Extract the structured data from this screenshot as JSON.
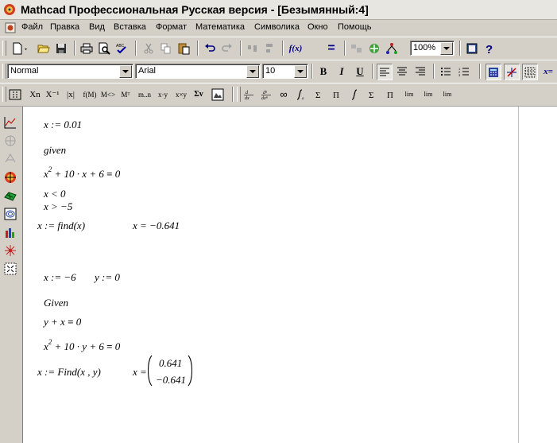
{
  "window": {
    "title": "Mathcad Профессиональная Русская версия - [Безымянный:4]"
  },
  "menu": [
    "Файл",
    "Правка",
    "Вид",
    "Вставка",
    "Формат",
    "Математика",
    "Символика",
    "Окно",
    "Помощь"
  ],
  "toolbar": {
    "zoom": "100%",
    "style": "Normal",
    "font": "Arial",
    "font_size": "10",
    "bold_label": "B",
    "italic_label": "I",
    "underline_label": "U",
    "fx_label": "f(x)",
    "equals_label": "=",
    "xeq_label": "x="
  },
  "palette_labels": {
    "subscript": "Xn",
    "inverse": "X⁻¹",
    "abs": "|x|",
    "vectorize": "f(M)",
    "superscript": "M<>",
    "transpose": "Mᵀ",
    "range": "m..n",
    "dot": "x·y",
    "cross": "x×y",
    "sum_vec": "Σv",
    "infinity": "∞",
    "lim": "lim"
  },
  "worksheet": {
    "expr1": "x := 0.01",
    "given1": "given",
    "eq1_left": "x",
    "eq1_rest": " + 10 · x + 6 ",
    "eq1_eq": "=",
    "eq1_rhs": " 0",
    "eq1_exp": "2",
    "ineq1": "x < 0",
    "ineq2": "x > −5",
    "find1": "x := find(x)",
    "result1": "x = −0.641",
    "init_x": "x := −6",
    "init_y": "y := 0",
    "given2": "Given",
    "eq2_left": "y + x ",
    "eq2_eq": "=",
    "eq2_rhs": " 0",
    "eq3_left": "x",
    "eq3_exp": "2",
    "eq3_rest": " + 10 · y + 6 ",
    "eq3_eq": "=",
    "eq3_rhs": " 0",
    "find2": "x := Find(x , y)",
    "result2_label": "x =",
    "result2_values": [
      "0.641",
      "−0.641"
    ]
  }
}
